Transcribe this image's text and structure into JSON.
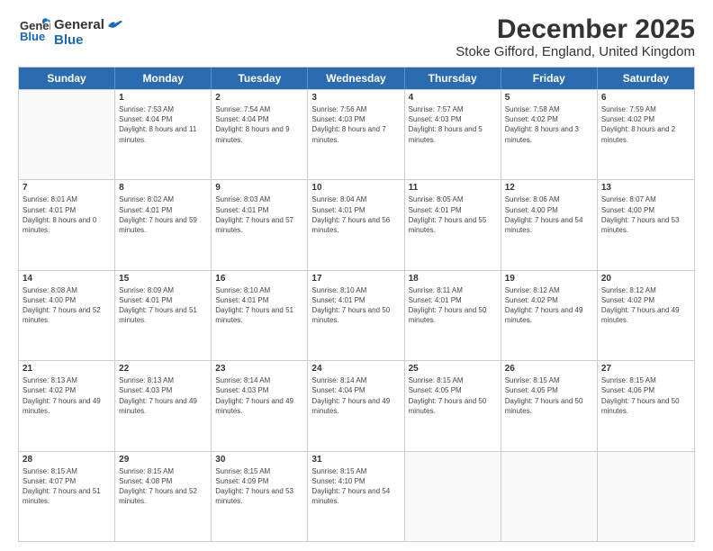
{
  "logo": {
    "line1": "General",
    "line2": "Blue"
  },
  "title": "December 2025",
  "subtitle": "Stoke Gifford, England, United Kingdom",
  "weekdays": [
    "Sunday",
    "Monday",
    "Tuesday",
    "Wednesday",
    "Thursday",
    "Friday",
    "Saturday"
  ],
  "weeks": [
    [
      {
        "day": "",
        "sunrise": "",
        "sunset": "",
        "daylight": ""
      },
      {
        "day": "1",
        "sunrise": "Sunrise: 7:53 AM",
        "sunset": "Sunset: 4:04 PM",
        "daylight": "Daylight: 8 hours and 11 minutes."
      },
      {
        "day": "2",
        "sunrise": "Sunrise: 7:54 AM",
        "sunset": "Sunset: 4:04 PM",
        "daylight": "Daylight: 8 hours and 9 minutes."
      },
      {
        "day": "3",
        "sunrise": "Sunrise: 7:56 AM",
        "sunset": "Sunset: 4:03 PM",
        "daylight": "Daylight: 8 hours and 7 minutes."
      },
      {
        "day": "4",
        "sunrise": "Sunrise: 7:57 AM",
        "sunset": "Sunset: 4:03 PM",
        "daylight": "Daylight: 8 hours and 5 minutes."
      },
      {
        "day": "5",
        "sunrise": "Sunrise: 7:58 AM",
        "sunset": "Sunset: 4:02 PM",
        "daylight": "Daylight: 8 hours and 3 minutes."
      },
      {
        "day": "6",
        "sunrise": "Sunrise: 7:59 AM",
        "sunset": "Sunset: 4:02 PM",
        "daylight": "Daylight: 8 hours and 2 minutes."
      }
    ],
    [
      {
        "day": "7",
        "sunrise": "Sunrise: 8:01 AM",
        "sunset": "Sunset: 4:01 PM",
        "daylight": "Daylight: 8 hours and 0 minutes."
      },
      {
        "day": "8",
        "sunrise": "Sunrise: 8:02 AM",
        "sunset": "Sunset: 4:01 PM",
        "daylight": "Daylight: 7 hours and 59 minutes."
      },
      {
        "day": "9",
        "sunrise": "Sunrise: 8:03 AM",
        "sunset": "Sunset: 4:01 PM",
        "daylight": "Daylight: 7 hours and 57 minutes."
      },
      {
        "day": "10",
        "sunrise": "Sunrise: 8:04 AM",
        "sunset": "Sunset: 4:01 PM",
        "daylight": "Daylight: 7 hours and 56 minutes."
      },
      {
        "day": "11",
        "sunrise": "Sunrise: 8:05 AM",
        "sunset": "Sunset: 4:01 PM",
        "daylight": "Daylight: 7 hours and 55 minutes."
      },
      {
        "day": "12",
        "sunrise": "Sunrise: 8:06 AM",
        "sunset": "Sunset: 4:00 PM",
        "daylight": "Daylight: 7 hours and 54 minutes."
      },
      {
        "day": "13",
        "sunrise": "Sunrise: 8:07 AM",
        "sunset": "Sunset: 4:00 PM",
        "daylight": "Daylight: 7 hours and 53 minutes."
      }
    ],
    [
      {
        "day": "14",
        "sunrise": "Sunrise: 8:08 AM",
        "sunset": "Sunset: 4:00 PM",
        "daylight": "Daylight: 7 hours and 52 minutes."
      },
      {
        "day": "15",
        "sunrise": "Sunrise: 8:09 AM",
        "sunset": "Sunset: 4:01 PM",
        "daylight": "Daylight: 7 hours and 51 minutes."
      },
      {
        "day": "16",
        "sunrise": "Sunrise: 8:10 AM",
        "sunset": "Sunset: 4:01 PM",
        "daylight": "Daylight: 7 hours and 51 minutes."
      },
      {
        "day": "17",
        "sunrise": "Sunrise: 8:10 AM",
        "sunset": "Sunset: 4:01 PM",
        "daylight": "Daylight: 7 hours and 50 minutes."
      },
      {
        "day": "18",
        "sunrise": "Sunrise: 8:11 AM",
        "sunset": "Sunset: 4:01 PM",
        "daylight": "Daylight: 7 hours and 50 minutes."
      },
      {
        "day": "19",
        "sunrise": "Sunrise: 8:12 AM",
        "sunset": "Sunset: 4:02 PM",
        "daylight": "Daylight: 7 hours and 49 minutes."
      },
      {
        "day": "20",
        "sunrise": "Sunrise: 8:12 AM",
        "sunset": "Sunset: 4:02 PM",
        "daylight": "Daylight: 7 hours and 49 minutes."
      }
    ],
    [
      {
        "day": "21",
        "sunrise": "Sunrise: 8:13 AM",
        "sunset": "Sunset: 4:02 PM",
        "daylight": "Daylight: 7 hours and 49 minutes."
      },
      {
        "day": "22",
        "sunrise": "Sunrise: 8:13 AM",
        "sunset": "Sunset: 4:03 PM",
        "daylight": "Daylight: 7 hours and 49 minutes."
      },
      {
        "day": "23",
        "sunrise": "Sunrise: 8:14 AM",
        "sunset": "Sunset: 4:03 PM",
        "daylight": "Daylight: 7 hours and 49 minutes."
      },
      {
        "day": "24",
        "sunrise": "Sunrise: 8:14 AM",
        "sunset": "Sunset: 4:04 PM",
        "daylight": "Daylight: 7 hours and 49 minutes."
      },
      {
        "day": "25",
        "sunrise": "Sunrise: 8:15 AM",
        "sunset": "Sunset: 4:05 PM",
        "daylight": "Daylight: 7 hours and 50 minutes."
      },
      {
        "day": "26",
        "sunrise": "Sunrise: 8:15 AM",
        "sunset": "Sunset: 4:05 PM",
        "daylight": "Daylight: 7 hours and 50 minutes."
      },
      {
        "day": "27",
        "sunrise": "Sunrise: 8:15 AM",
        "sunset": "Sunset: 4:06 PM",
        "daylight": "Daylight: 7 hours and 50 minutes."
      }
    ],
    [
      {
        "day": "28",
        "sunrise": "Sunrise: 8:15 AM",
        "sunset": "Sunset: 4:07 PM",
        "daylight": "Daylight: 7 hours and 51 minutes."
      },
      {
        "day": "29",
        "sunrise": "Sunrise: 8:15 AM",
        "sunset": "Sunset: 4:08 PM",
        "daylight": "Daylight: 7 hours and 52 minutes."
      },
      {
        "day": "30",
        "sunrise": "Sunrise: 8:15 AM",
        "sunset": "Sunset: 4:09 PM",
        "daylight": "Daylight: 7 hours and 53 minutes."
      },
      {
        "day": "31",
        "sunrise": "Sunrise: 8:15 AM",
        "sunset": "Sunset: 4:10 PM",
        "daylight": "Daylight: 7 hours and 54 minutes."
      },
      {
        "day": "",
        "sunrise": "",
        "sunset": "",
        "daylight": ""
      },
      {
        "day": "",
        "sunrise": "",
        "sunset": "",
        "daylight": ""
      },
      {
        "day": "",
        "sunrise": "",
        "sunset": "",
        "daylight": ""
      }
    ]
  ]
}
